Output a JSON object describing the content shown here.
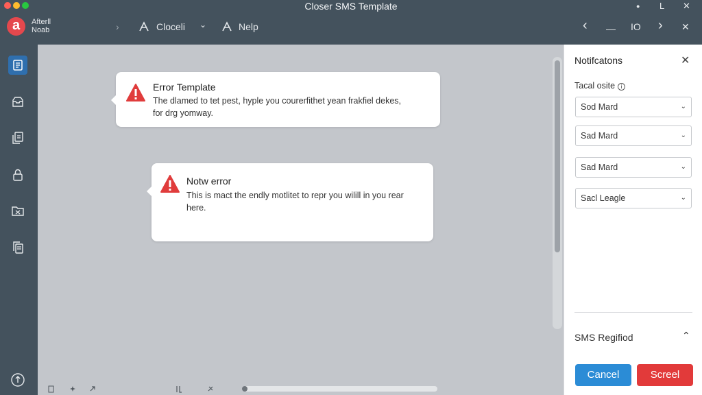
{
  "window": {
    "title": "Closer SMS Template",
    "controls": [
      "●",
      "L",
      "✕"
    ]
  },
  "brand": {
    "logo_letter": "a",
    "line1": "Afterll",
    "line2": "Noab"
  },
  "toolbar": {
    "chevron": "›",
    "item1_label": "Cloceli",
    "item1_caret": "⌄",
    "item2_label": "Nelp",
    "right": {
      "back": "‹",
      "min": "—",
      "io": "IO",
      "forward": "›",
      "close": "✕"
    }
  },
  "messages": [
    {
      "title": "Error Template",
      "body_line1": "The dlamed to tet pest, hyple you courerfithet yean frakfiel dekes,",
      "body_line2": "for drg yomway."
    },
    {
      "title": "Notw error",
      "body_line1": "This is mact the endly motlitet to repr you wilill in you rear",
      "body_line2": "here."
    }
  ],
  "panel": {
    "title": "Notifcatons",
    "close": "✕",
    "field_label": "Tacal osite",
    "info": "i",
    "selects": [
      "Sod Mard",
      "Sad Mard",
      "Sad Mard",
      "Sacl Leagle"
    ],
    "select_chevron": "⌄",
    "collapse_label": "SMS Regifiod",
    "collapse_chevron": "⌃",
    "cancel_label": "Cancel",
    "screel_label": "Screel"
  },
  "colors": {
    "chrome": "#44525d",
    "canvas": "#c3c6cb",
    "accent_blue": "#2b8cd6",
    "danger_red": "#e23a3a",
    "warning_red": "#e03c3c",
    "active_sidebar": "#2f6fae"
  }
}
